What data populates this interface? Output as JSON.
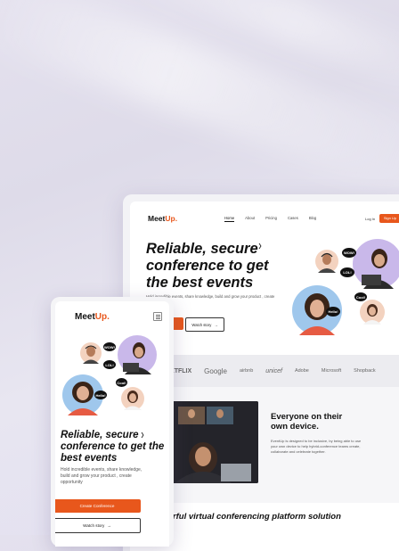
{
  "desktop": {
    "logo_main": "Meet",
    "logo_accent": "Up.",
    "nav": [
      "Home",
      "About",
      "Pricing",
      "Cases",
      "Blog"
    ],
    "login": "Log In",
    "signup": "Sign Up",
    "headline": "Reliable, secure conference to get the best events",
    "subtext": "Hold incredible events, share knowledge, build and grow your product , create opportunity",
    "watch_label": "Watch story",
    "bubbles": [
      "WOW!",
      "LOL!",
      "Cool!",
      "Hello!"
    ],
    "logos": [
      "NETFLIX",
      "Google",
      "airbnb",
      "unicef",
      "Adobe",
      "Microsoft",
      "Shopback"
    ],
    "section_title": "Everyone on their own device.",
    "section_text": "EventUp is designed to be inclusive, by being able to use your own device to help hybrid-conference teams create, collaborate and celebrate together.",
    "bottom_title": "Powerful virtual conferencing platform solution"
  },
  "mobile": {
    "logo_main": "Meet",
    "logo_accent": "Up.",
    "bubbles": [
      "WOW!",
      "LOL!",
      "Cool!",
      "Hello!"
    ],
    "headline": "Reliable, secure conference to get the best events",
    "subtext": "Hold incredible events, share knowledge, build and grow your product , create opportunity",
    "create_label": "Create Conference",
    "watch_label": "Watch story"
  },
  "colors": {
    "accent": "#e8571c",
    "purple": "#c9b8ea",
    "blue": "#9fc7ec",
    "peach": "#f3d2bf"
  }
}
